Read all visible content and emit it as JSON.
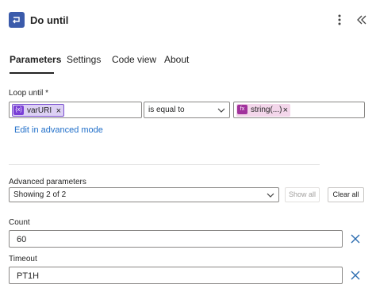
{
  "header": {
    "title": "Do until",
    "icon": "do-until-loop-icon",
    "more_icon": "more-vertical-icon",
    "collapse_icon": "double-chevron-left-icon"
  },
  "tabs": [
    {
      "label": "Parameters",
      "active": true
    },
    {
      "label": "Settings",
      "active": false
    },
    {
      "label": "Code view",
      "active": false
    },
    {
      "label": "About",
      "active": false
    }
  ],
  "loop_until": {
    "label": "Loop until *",
    "left_token": {
      "icon_text": "{x}",
      "label": "varURI",
      "remove": "×"
    },
    "operator": "is equal to",
    "right_token": {
      "icon_text": "fx",
      "label": "string(...)",
      "remove": "×"
    },
    "advanced_mode_link": "Edit in advanced mode"
  },
  "advanced": {
    "label": "Advanced parameters",
    "selected": "Showing 2 of 2",
    "show_all": "Show all",
    "clear_all": "Clear all"
  },
  "fields": {
    "count": {
      "label": "Count",
      "value": "60"
    },
    "timeout": {
      "label": "Timeout",
      "value": "PT1H"
    }
  },
  "colors": {
    "accent": "#1f6ec9",
    "header_icon_bg": "#3b5bab",
    "var_token_bg": "#dcd0f4",
    "fn_token_bg": "#f3d6ea",
    "clear_icon": "#2b6cb0"
  }
}
